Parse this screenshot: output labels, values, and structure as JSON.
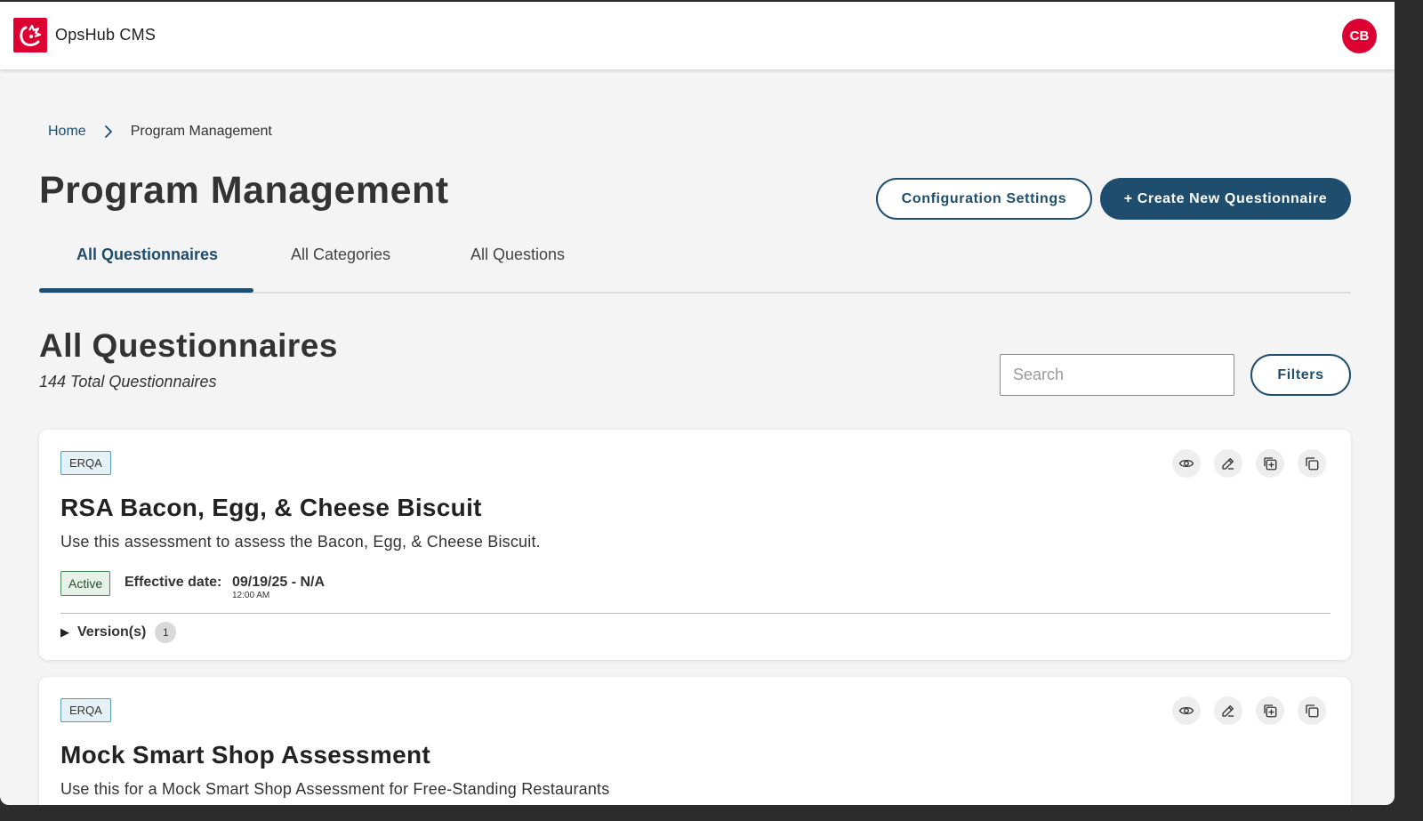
{
  "header": {
    "app_title": "OpsHub CMS",
    "avatar_initials": "CB",
    "brand_color": "#dd0033"
  },
  "breadcrumb": {
    "home": "Home",
    "current": "Program Management"
  },
  "page": {
    "title": "Program Management",
    "config_button": "Configuration Settings",
    "create_button": "+ Create New Questionnaire",
    "accent_color": "#1f4d6e"
  },
  "tabs": [
    {
      "label": "All Questionnaires",
      "active": true
    },
    {
      "label": "All Categories",
      "active": false
    },
    {
      "label": "All Questions",
      "active": false
    }
  ],
  "section": {
    "title": "All Questionnaires",
    "count_text": "144 Total Questionnaires",
    "search_placeholder": "Search",
    "filters_button": "Filters"
  },
  "questionnaires": [
    {
      "tag": "ERQA",
      "title": "RSA Bacon, Egg, & Cheese Biscuit",
      "description": "Use this assessment to assess the Bacon, Egg, & Cheese Biscuit.",
      "status": "Active",
      "effective_label": "Effective date:",
      "effective_date": "09/19/25 - N/A",
      "effective_time": "12:00 AM",
      "versions_label": "Version(s)",
      "versions_count": "1",
      "actions": [
        "eye-icon",
        "edit-icon",
        "duplicate-add-icon",
        "copy-icon"
      ]
    },
    {
      "tag": "ERQA",
      "title": "Mock Smart Shop Assessment",
      "description": "Use this for a Mock Smart Shop Assessment for Free-Standing Restaurants",
      "actions": [
        "eye-icon",
        "edit-icon",
        "duplicate-add-icon",
        "copy-icon"
      ]
    }
  ]
}
